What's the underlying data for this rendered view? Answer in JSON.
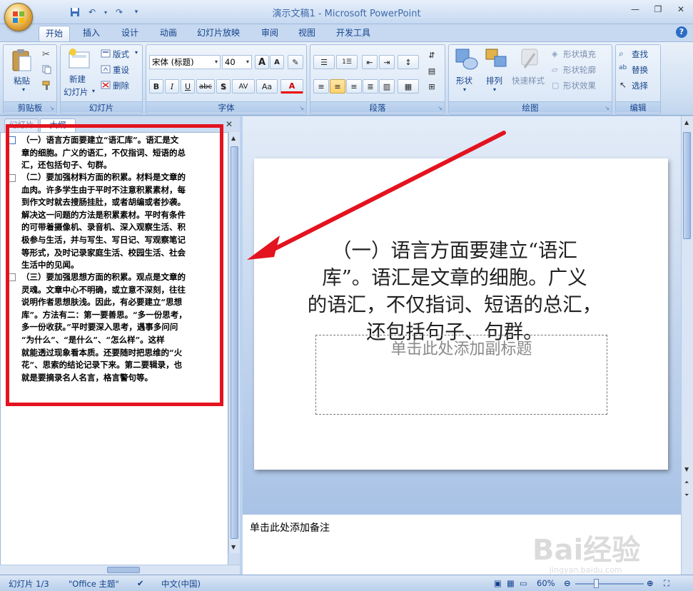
{
  "window": {
    "title": "演示文稿1 - Microsoft PowerPoint"
  },
  "tabs": [
    "开始",
    "插入",
    "设计",
    "动画",
    "幻灯片放映",
    "审阅",
    "视图",
    "开发工具"
  ],
  "ribbon": {
    "clipboard": {
      "label": "剪贴板",
      "paste": "粘贴"
    },
    "slides": {
      "label": "幻灯片",
      "new_slide_1": "新建",
      "new_slide_2": "幻灯片",
      "layout": "版式",
      "reset": "重设",
      "delete": "删除"
    },
    "font": {
      "label": "字体",
      "font_name": "宋体 (标题)",
      "font_size": "40",
      "bold": "B",
      "italic": "I",
      "underline": "U",
      "strike": "abc",
      "shadow": "S",
      "spacing": "AV",
      "case": "Aa",
      "color": "A",
      "grow": "A",
      "shrink": "A"
    },
    "paragraph": {
      "label": "段落"
    },
    "drawing": {
      "label": "绘图",
      "shapes": "形状",
      "arrange": "排列",
      "quick_styles": "快速样式",
      "fill": "形状填充",
      "outline": "形状轮廓",
      "effects": "形状效果"
    },
    "editing": {
      "label": "编辑",
      "find": "查找",
      "replace": "替换",
      "select": "选择"
    }
  },
  "left_pane": {
    "tabs": [
      "幻灯片",
      "大纲"
    ],
    "paragraphs": [
      {
        "lines": [
          "（一）语言方面要建立“语汇库”。语汇是文",
          "章的细胞。广义的语汇，不仅指词、短语的总",
          "汇，还包括句子、句群。"
        ]
      },
      {
        "lines": [
          "（二）要加强材料方面的积累。材料是文章的",
          "血肉。许多学生由于平时不注意积累素材，每",
          "到作文时就去搜肠挂肚，或者胡编或者抄袭。",
          "解决这一问题的方法是积累素材。平时有条件",
          "的可带着摄像机、录音机、深入观察生活、积",
          "极参与生活，并与写生、写日记、写观察笔记",
          "等形式，及时记录家庭生活、校园生活、社会",
          "生活中的见闻。"
        ]
      },
      {
        "lines": [
          "（三）要加强思想方面的积累。观点是文章的",
          "灵魂。文章中心不明确，或立意不深刻，往往",
          "说明作者思想肤浅。因此，有必要建立“思想",
          "库”。方法有二：第一要善思。“多一份思考，",
          "多一份收获。”平时要深入思考，遇事多问问",
          "“为什么”、“是什么”、“怎么样”。这样",
          "就能透过现象看本质。还要随时把思维的“火",
          "花”、思索的结论记录下来。第二要辑录，也",
          "就是要摘录名人名言，格言警句等。"
        ]
      }
    ]
  },
  "slide": {
    "title_lines": [
      "（一）语言方面要建立“语汇",
      "库”。语汇是文章的细胞。广义",
      "的语汇，不仅指词、短语的总汇，",
      "还包括句子、句群。"
    ],
    "subtitle_placeholder": "单击此处添加副标题"
  },
  "notes": {
    "placeholder": "单击此处添加备注"
  },
  "status": {
    "slide": "幻灯片 1/3",
    "theme": "\"Office 主题\"",
    "language": "中文(中国)",
    "zoom": "60%"
  },
  "watermark": "Bai经验",
  "watermark_url": "jingyan.baidu.com",
  "colors": {
    "annotation_red": "#e3131f",
    "ribbon_blue": "#15428b"
  }
}
